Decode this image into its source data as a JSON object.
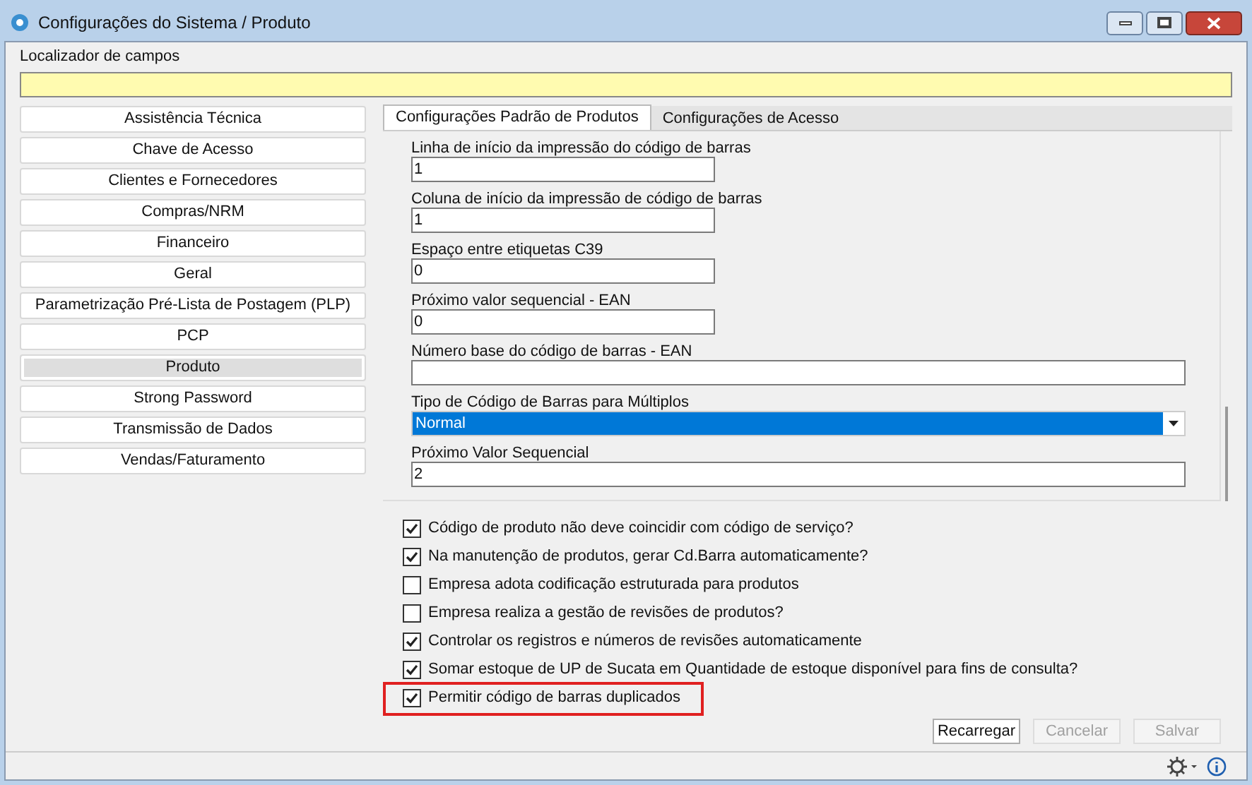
{
  "window": {
    "title": "Configurações do Sistema / Produto"
  },
  "locator": {
    "label": "Localizador de campos"
  },
  "sidebar": {
    "items": [
      {
        "label": "Assistência Técnica",
        "selected": false
      },
      {
        "label": "Chave de Acesso",
        "selected": false
      },
      {
        "label": "Clientes e Fornecedores",
        "selected": false
      },
      {
        "label": "Compras/NRM",
        "selected": false
      },
      {
        "label": "Financeiro",
        "selected": false
      },
      {
        "label": "Geral",
        "selected": false
      },
      {
        "label": "Parametrização Pré-Lista de Postagem (PLP)",
        "selected": false
      },
      {
        "label": "PCP",
        "selected": false
      },
      {
        "label": "Produto",
        "selected": true
      },
      {
        "label": "Strong Password",
        "selected": false
      },
      {
        "label": "Transmissão de Dados",
        "selected": false
      },
      {
        "label": "Vendas/Faturamento",
        "selected": false
      }
    ]
  },
  "tabs": [
    {
      "label": "Configurações Padrão de Produtos",
      "selected": true
    },
    {
      "label": "Configurações de Acesso",
      "selected": false
    }
  ],
  "fields": [
    {
      "kind": "text",
      "label": "Linha de início da impressão do código de barras",
      "value": "1",
      "wide": false
    },
    {
      "kind": "text",
      "label": "Coluna de início da impressão de código de barras",
      "value": "1",
      "wide": false
    },
    {
      "kind": "text",
      "label": "Espaço entre etiquetas C39",
      "value": "0",
      "wide": false
    },
    {
      "kind": "text",
      "label": "Próximo valor sequencial - EAN",
      "value": "0",
      "wide": false
    },
    {
      "kind": "text",
      "label": "Número base do código de barras - EAN",
      "wide": true
    },
    {
      "kind": "select",
      "label": "Tipo de Código de Barras para Múltiplos",
      "value": "Normal",
      "wide": true
    },
    {
      "kind": "text",
      "label": "Próximo Valor Sequencial",
      "value": "2",
      "wide": true
    }
  ],
  "checkboxes": [
    {
      "label": "Código de produto não deve coincidir com código de serviço?",
      "checked": true,
      "highlighted": false
    },
    {
      "label": "Na manutenção de produtos, gerar Cd.Barra automaticamente?",
      "checked": true,
      "highlighted": false
    },
    {
      "label": "Empresa adota codificação estruturada para produtos",
      "checked": false,
      "highlighted": false
    },
    {
      "label": "Empresa realiza a gestão de revisões de produtos?",
      "checked": false,
      "highlighted": false
    },
    {
      "label": "Controlar os registros e números de revisões automaticamente",
      "checked": true,
      "highlighted": false
    },
    {
      "label": "Somar estoque de UP de Sucata em Quantidade de estoque disponível para fins de consulta?",
      "checked": true,
      "highlighted": false
    },
    {
      "label": "Permitir código de barras duplicados",
      "checked": true,
      "highlighted": true
    }
  ],
  "buttons": [
    {
      "label": "Recarregar",
      "disabled": false
    },
    {
      "label": "Cancelar",
      "disabled": true
    },
    {
      "label": "Salvar",
      "disabled": true
    }
  ]
}
